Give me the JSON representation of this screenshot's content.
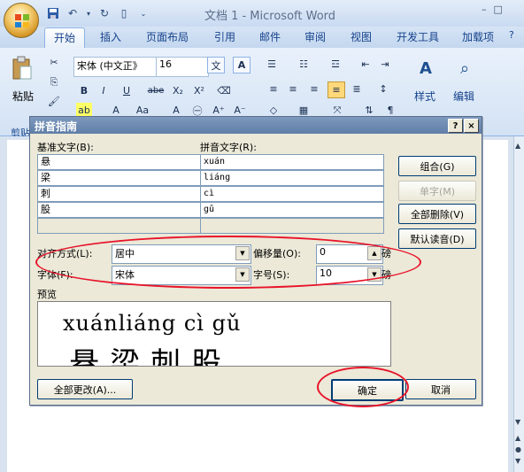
{
  "window": {
    "title": "文档 1 - Microsoft Word",
    "controls": [
      "–",
      "□"
    ]
  },
  "quick_access": [
    "save-icon",
    "undo-icon",
    "redo-icon",
    "print-preview-icon",
    "dropdown-icon"
  ],
  "ribbon": {
    "tabs": [
      "开始",
      "插入",
      "页面布局",
      "引用",
      "邮件",
      "审阅",
      "视图",
      "开发工具",
      "加载项"
    ],
    "active_tab": "开始",
    "font_name": "宋体 (中文正》",
    "font_size": "16",
    "paste_label": "粘贴",
    "clipboard_label": "剪贴",
    "style_label": "样式",
    "edit_label": "编辑",
    "bold": "B",
    "italic": "I",
    "underline": "U",
    "strike": "abe",
    "subscript": "X₂",
    "superscript": "X²",
    "font_color_a": "A",
    "grow": "A⁺",
    "shrink": "A⁻",
    "change_case": "Aa",
    "char_border": "A",
    "enclose": "㊀",
    "phonetic": "文",
    "style_glyph": "A",
    "find_glyph": "🔍"
  },
  "dialog": {
    "title": "拼音指南",
    "help": "?",
    "close": "×",
    "base_text_label": "基准文字(B):",
    "ruby_text_label": "拼音文字(R):",
    "rows": [
      {
        "base": "悬",
        "ruby": "xuán"
      },
      {
        "base": "梁",
        "ruby": "liáng"
      },
      {
        "base": "刺",
        "ruby": "cì"
      },
      {
        "base": "股",
        "ruby": "gǔ"
      },
      {
        "base": "",
        "ruby": ""
      }
    ],
    "buttons": {
      "group": "组合(G)",
      "mono": "单字(M)",
      "clear_all": "全部删除(V)",
      "default_reading": "默认读音(D)",
      "apply_all": "全部更改(A)...",
      "ok": "确定",
      "cancel": "取消"
    },
    "alignment_label": "对齐方式(L):",
    "alignment_value": "居中",
    "offset_label": "偏移量(O):",
    "offset_value": "0",
    "offset_unit": "磅",
    "font_label": "字体(F):",
    "font_value": "宋体",
    "size_label": "字号(S):",
    "size_value": "10",
    "size_unit": "磅",
    "preview_label": "预览",
    "preview_pinyin": "xuánliáng cì  gǔ",
    "preview_hanzi": "悬梁刺股"
  },
  "colors": {
    "highlight_ellipse": "#e8142a",
    "dialog_face": "#ece9d8",
    "ribbon_blue": "#15428b"
  }
}
